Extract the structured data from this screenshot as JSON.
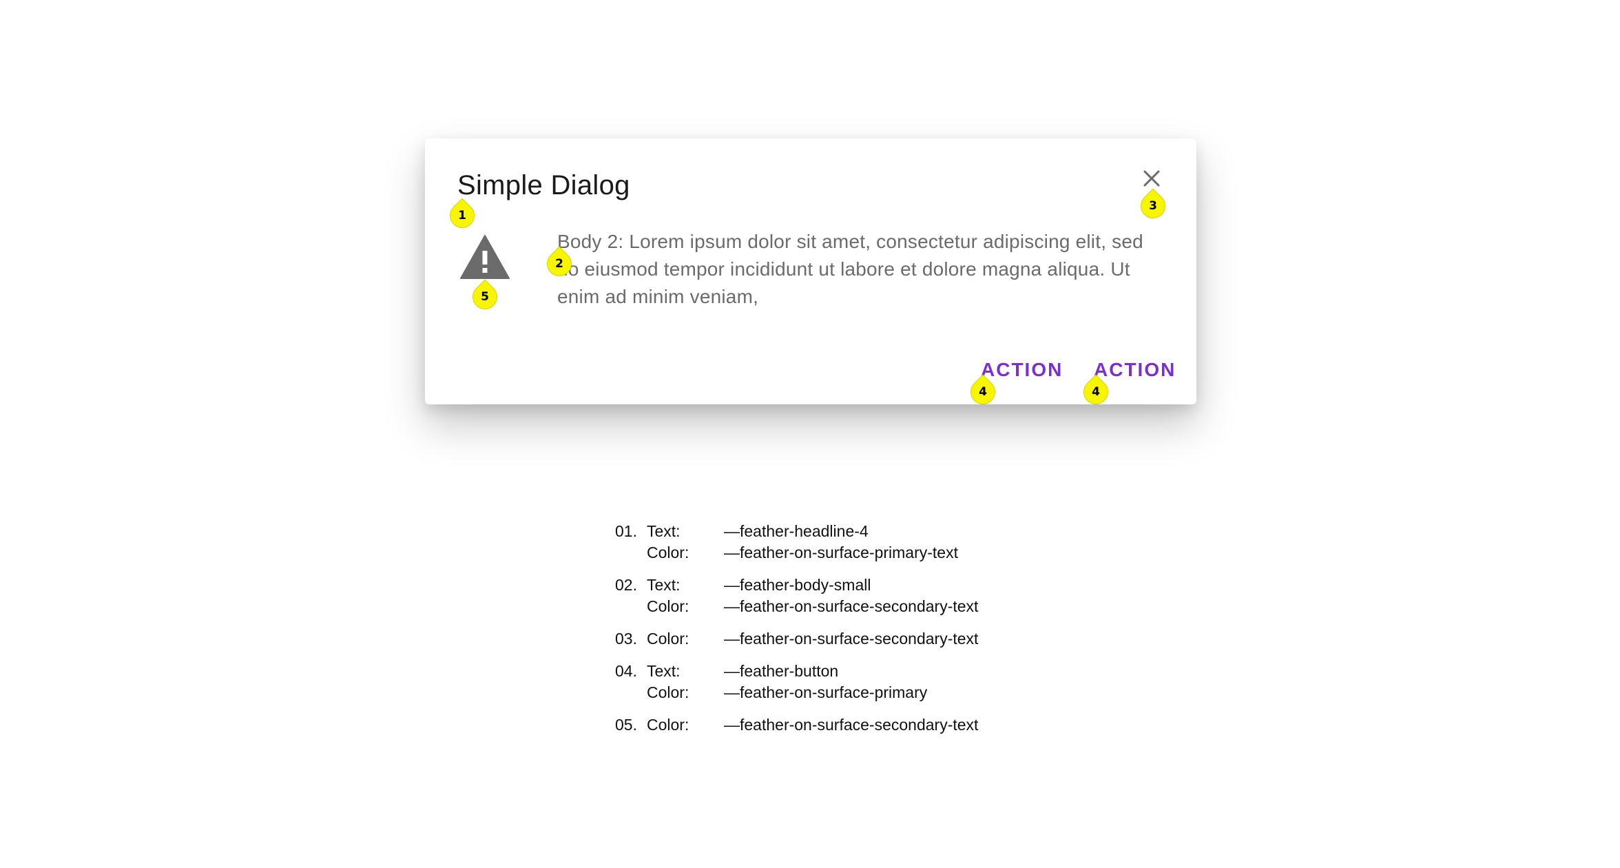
{
  "dialog": {
    "title": "Simple Dialog",
    "close_icon": "close-icon",
    "warning_icon": "warning-triangle-icon",
    "body": "Body 2: Lorem ipsum dolor sit amet, consectetur adipiscing elit, sed do eiusmod tempor incididunt ut labore et dolore magna aliqua. Ut enim ad minim veniam,",
    "actions": [
      "ACTION",
      "ACTION"
    ],
    "colors": {
      "title": "#1a1a1a",
      "body": "#6b6b6b",
      "action": "#7b2fd1",
      "icon": "#6b6b6b",
      "marker": "#f7f500"
    }
  },
  "markers": [
    "1",
    "2",
    "3",
    "4",
    "4",
    "5"
  ],
  "legend": [
    {
      "num": "01.",
      "rows": [
        {
          "key": "Text:",
          "value": "—feather-headline-4"
        },
        {
          "key": "Color:",
          "value": "—feather-on-surface-primary-text"
        }
      ]
    },
    {
      "num": "02.",
      "rows": [
        {
          "key": "Text:",
          "value": "—feather-body-small"
        },
        {
          "key": "Color:",
          "value": "—feather-on-surface-secondary-text"
        }
      ]
    },
    {
      "num": "03.",
      "rows": [
        {
          "key": "Color:",
          "value": "—feather-on-surface-secondary-text"
        }
      ]
    },
    {
      "num": "04.",
      "rows": [
        {
          "key": "Text:",
          "value": "—feather-button"
        },
        {
          "key": "Color:",
          "value": "—feather-on-surface-primary"
        }
      ]
    },
    {
      "num": "05.",
      "rows": [
        {
          "key": "Color:",
          "value": "—feather-on-surface-secondary-text"
        }
      ]
    }
  ]
}
